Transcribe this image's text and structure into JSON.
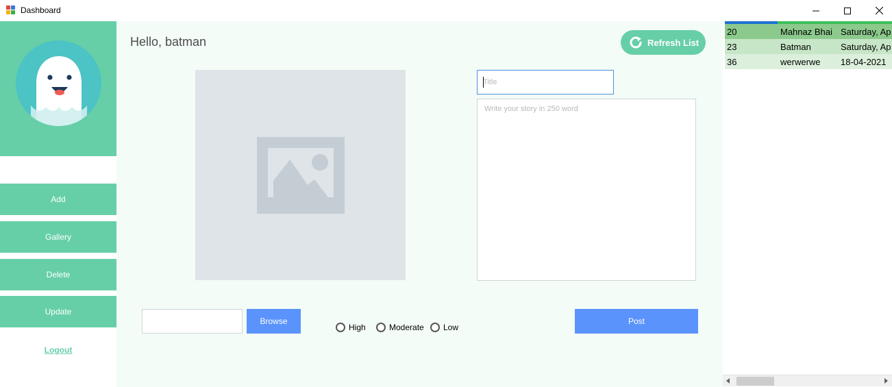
{
  "window": {
    "title": "Dashboard",
    "icons": {
      "app": "dashboard-app-icon",
      "minimize": "minimize-icon",
      "maximize": "maximize-icon",
      "close": "close-icon"
    }
  },
  "sidebar": {
    "avatar_icon": "ghost-avatar",
    "nav": [
      "Add",
      "Gallery",
      "Delete",
      "Update"
    ],
    "logout": "Logout"
  },
  "main": {
    "greeting": "Hello, batman",
    "refresh_label": "Refresh List",
    "refresh_icon": "refresh-icon",
    "image_placeholder_icon": "image-placeholder-icon",
    "title_placeholder": "Title",
    "story_placeholder": "Write your story in 250 word",
    "browse_label": "Browse",
    "priority_options": [
      "High",
      "Moderate",
      "Low"
    ],
    "post_label": "Post"
  },
  "grid": {
    "rows": [
      {
        "id": "20",
        "name": "Mahnaz Bhai",
        "date": "Saturday, Ap"
      },
      {
        "id": "23",
        "name": "Batman",
        "date": "Saturday, Ap"
      },
      {
        "id": "36",
        "name": "werwerwe",
        "date": "18-04-2021"
      }
    ],
    "scroll_left_icon": "scroll-left-icon",
    "scroll_right_icon": "scroll-right-icon"
  },
  "colors": {
    "accent_green": "#66cfa8",
    "avatar_bg": "#4cc3c5",
    "main_bg": "#f3fcf7",
    "button_blue": "#5b93fc",
    "grid_row_dark": "#8cc98c",
    "grid_row_mid": "#c7e6c7",
    "grid_row_light": "#dcefdc",
    "grid_accent_green": "#3dbf5b",
    "grid_accent_blue": "#1e73d2"
  }
}
